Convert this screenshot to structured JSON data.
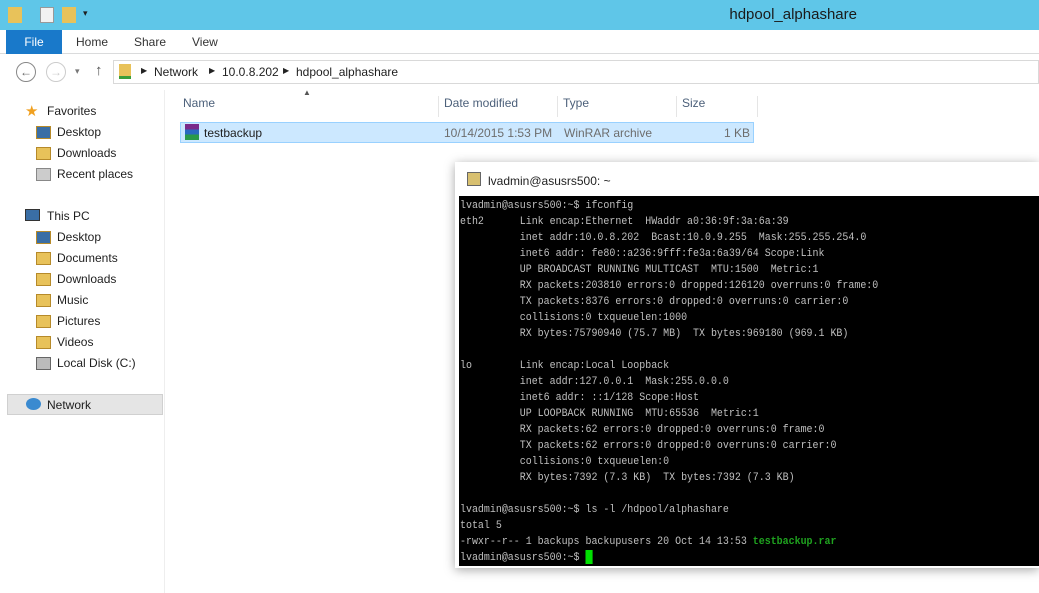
{
  "window": {
    "title": "hdpool_alphashare"
  },
  "ribbon": {
    "tabs": [
      "File",
      "Home",
      "Share",
      "View"
    ]
  },
  "address": {
    "crumbs": [
      "Network",
      "10.0.8.202",
      "hdpool_alphashare"
    ]
  },
  "sidebar": {
    "favorites": {
      "label": "Favorites",
      "items": [
        "Desktop",
        "Downloads",
        "Recent places"
      ]
    },
    "this_pc": {
      "label": "This PC",
      "items": [
        "Desktop",
        "Documents",
        "Downloads",
        "Music",
        "Pictures",
        "Videos",
        "Local Disk (C:)"
      ]
    },
    "network": "Network"
  },
  "columns": [
    "Name",
    "Date modified",
    "Type",
    "Size"
  ],
  "files": [
    {
      "name": "testbackup",
      "date": "10/14/2015 1:53 PM",
      "type": "WinRAR archive",
      "size": "1 KB"
    }
  ],
  "terminal": {
    "title": "lvadmin@asusrs500: ~",
    "lines": [
      "lvadmin@asusrs500:~$ ifconfig",
      "eth2      Link encap:Ethernet  HWaddr a0:36:9f:3a:6a:39",
      "          inet addr:10.0.8.202  Bcast:10.0.9.255  Mask:255.255.254.0",
      "          inet6 addr: fe80::a236:9fff:fe3a:6a39/64 Scope:Link",
      "          UP BROADCAST RUNNING MULTICAST  MTU:1500  Metric:1",
      "          RX packets:203810 errors:0 dropped:126120 overruns:0 frame:0",
      "          TX packets:8376 errors:0 dropped:0 overruns:0 carrier:0",
      "          collisions:0 txqueuelen:1000",
      "          RX bytes:75790940 (75.7 MB)  TX bytes:969180 (969.1 KB)",
      "",
      "lo        Link encap:Local Loopback",
      "          inet addr:127.0.0.1  Mask:255.0.0.0",
      "          inet6 addr: ::1/128 Scope:Host",
      "          UP LOOPBACK RUNNING  MTU:65536  Metric:1",
      "          RX packets:62 errors:0 dropped:0 overruns:0 frame:0",
      "          TX packets:62 errors:0 dropped:0 overruns:0 carrier:0",
      "          collisions:0 txqueuelen:0",
      "          RX bytes:7392 (7.3 KB)  TX bytes:7392 (7.3 KB)",
      "",
      "lvadmin@asusrs500:~$ ls -l /hdpool/alphashare",
      "total 5"
    ],
    "ls_prefix": "-rwxr--r-- 1 backups backupusers 20 Oct 14 13:53 ",
    "ls_file": "testbackup.rar",
    "prompt": "lvadmin@asusrs500:~$ "
  }
}
